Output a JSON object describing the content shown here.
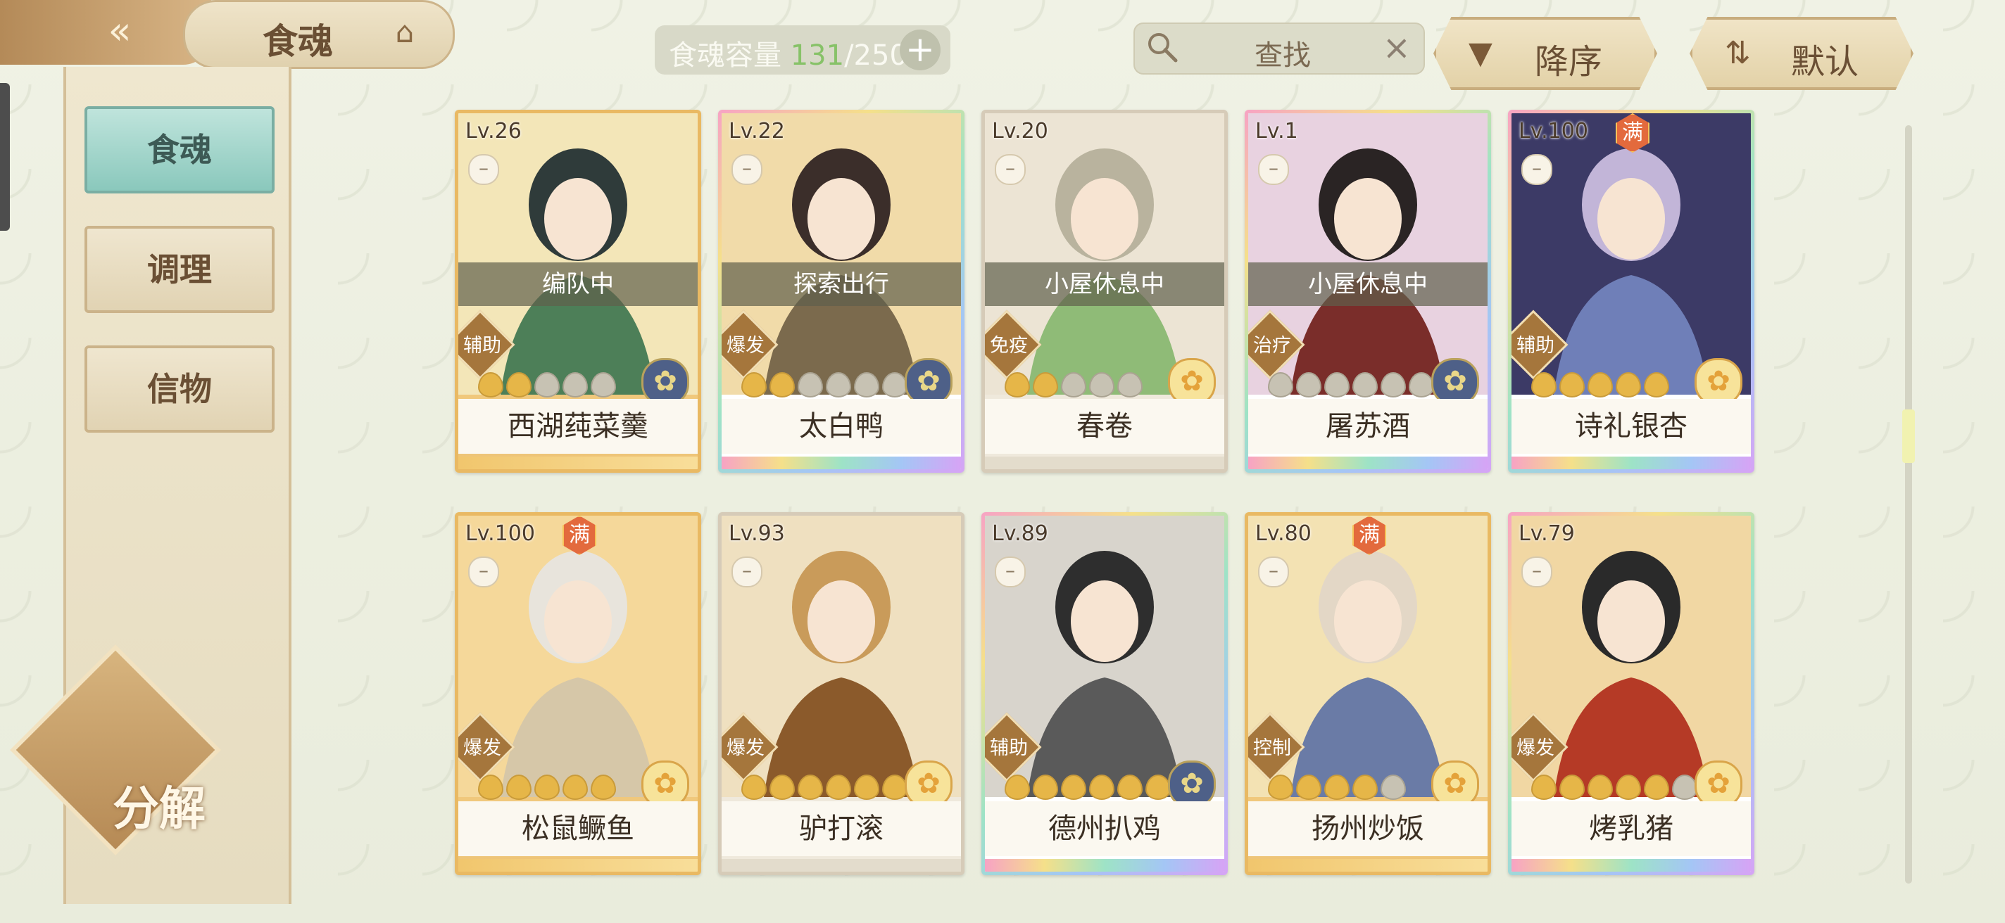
{
  "header": {
    "title": "食魂",
    "capacity_label": "食魂容量",
    "capacity_current": "131",
    "capacity_sep_total": "/250",
    "search_placeholder": "查找",
    "sort_label": "降序",
    "default_label": "默认"
  },
  "sidebar": {
    "tabs": [
      {
        "label": "食魂",
        "active": true
      },
      {
        "label": "调理",
        "active": false
      },
      {
        "label": "信物",
        "active": false
      }
    ],
    "decompose_label": "分解"
  },
  "icons": {
    "back": "back-arrow-icon",
    "title": "pavilion-icon",
    "capacity_add": "plus-icon",
    "search": "search-icon",
    "clear": "close-icon",
    "sort": "triangle-down-icon",
    "default": "sort-toggle-icon",
    "lock": "lock-icon",
    "star": "star-icon",
    "emblem": "flower-emblem-icon"
  },
  "colors": {
    "accent_green": "#87c268",
    "gold_border": "#e9b963",
    "active_tab": "#8ac8bc",
    "max_badge": "#e36a3d"
  },
  "cards": [
    {
      "level": "Lv.26",
      "max": "",
      "status": "编队中",
      "role": "辅助",
      "name": "西湖莼菜羹",
      "rarity": "gold",
      "stars": 2,
      "total_stars": 5,
      "emblem": "blue"
    },
    {
      "level": "Lv.22",
      "max": "",
      "status": "探索出行",
      "role": "爆发",
      "name": "太白鸭",
      "rarity": "rainbow",
      "stars": 2,
      "total_stars": 6,
      "emblem": "blue"
    },
    {
      "level": "Lv.20",
      "max": "",
      "status": "小屋休息中",
      "role": "免疫",
      "name": "春卷",
      "rarity": "grey",
      "stars": 2,
      "total_stars": 5,
      "emblem": "gold"
    },
    {
      "level": "Lv.1",
      "max": "",
      "status": "小屋休息中",
      "role": "治疗",
      "name": "屠苏酒",
      "rarity": "rainbow",
      "stars": 0,
      "total_stars": 6,
      "emblem": "blue"
    },
    {
      "level": "Lv.100",
      "max": "满",
      "status": "",
      "role": "辅助",
      "name": "诗礼银杏",
      "rarity": "rainbow",
      "stars": 5,
      "total_stars": 5,
      "emblem": "gold"
    },
    {
      "level": "Lv.100",
      "max": "满",
      "status": "",
      "role": "爆发",
      "name": "松鼠鳜鱼",
      "rarity": "gold",
      "stars": 5,
      "total_stars": 5,
      "emblem": "gold"
    },
    {
      "level": "Lv.93",
      "max": "",
      "status": "",
      "role": "爆发",
      "name": "驴打滚",
      "rarity": "grey",
      "stars": 6,
      "total_stars": 6,
      "emblem": "gold"
    },
    {
      "level": "Lv.89",
      "max": "",
      "status": "",
      "role": "辅助",
      "name": "德州扒鸡",
      "rarity": "rainbow",
      "stars": 6,
      "total_stars": 6,
      "emblem": "blue"
    },
    {
      "level": "Lv.80",
      "max": "满",
      "status": "",
      "role": "控制",
      "name": "扬州炒饭",
      "rarity": "gold",
      "stars": 4,
      "total_stars": 5,
      "emblem": "gold"
    },
    {
      "level": "Lv.79",
      "max": "",
      "status": "",
      "role": "爆发",
      "name": "烤乳猪",
      "rarity": "rainbow",
      "stars": 5,
      "total_stars": 6,
      "emblem": "gold"
    }
  ]
}
